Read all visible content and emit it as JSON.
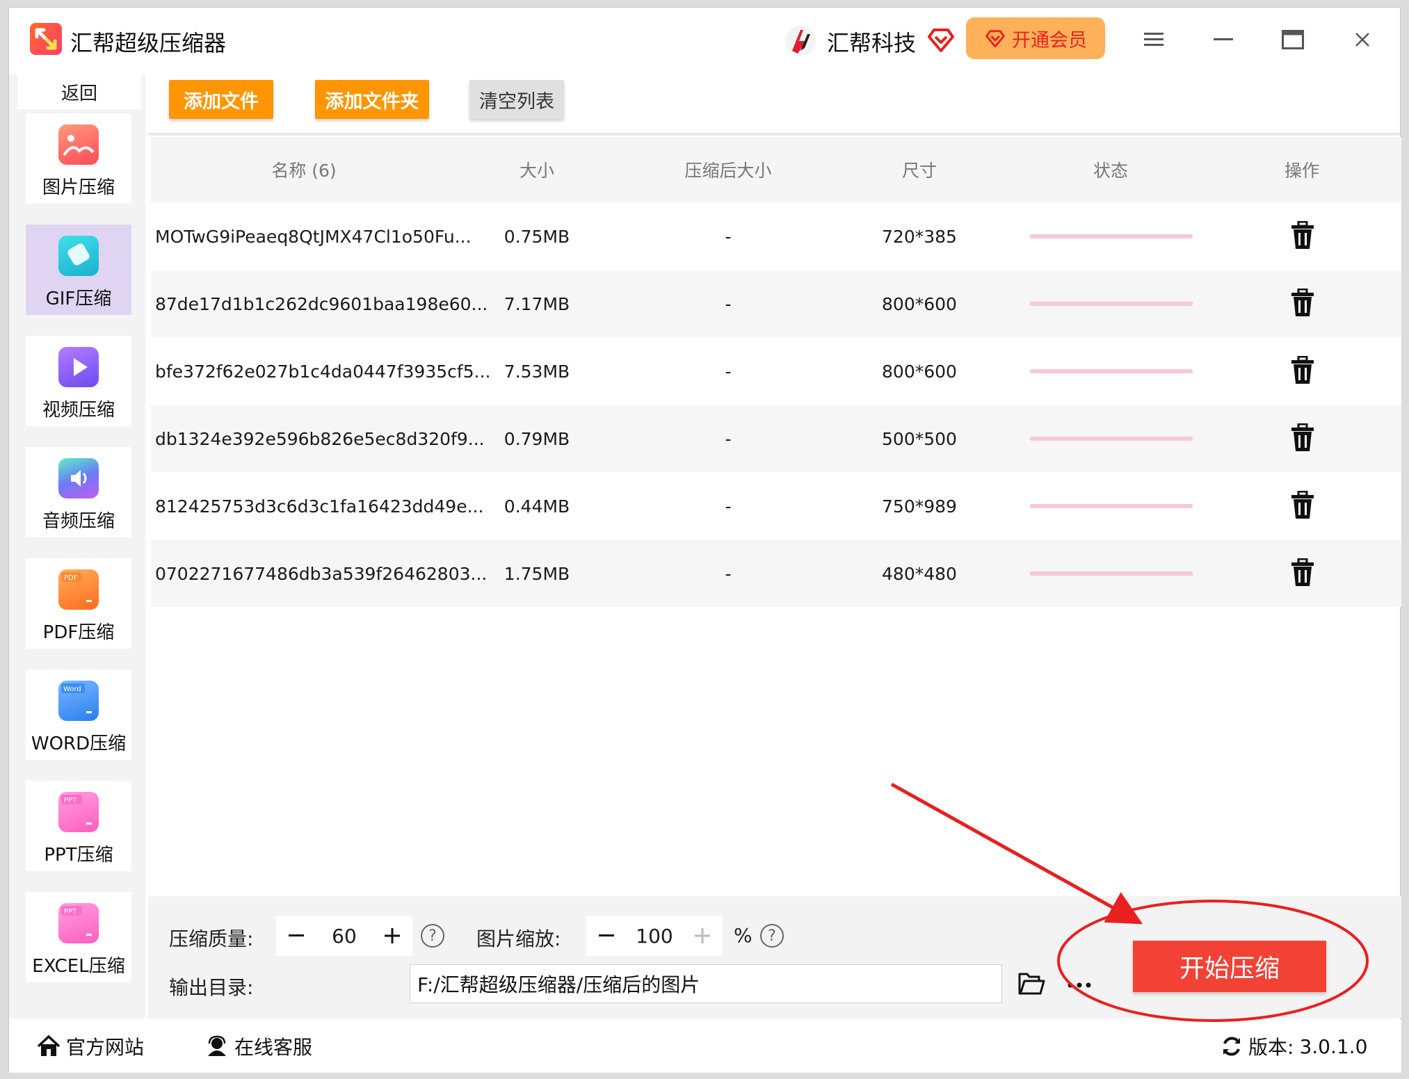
{
  "app": {
    "title": "汇帮超级压缩器",
    "brand_name": "汇帮科技",
    "vip_label": "开通会员"
  },
  "sidebar": {
    "back_label": "返回",
    "items": [
      {
        "label": "图片压缩",
        "icon": "image-icon",
        "color": "#ff5a5a",
        "active": false
      },
      {
        "label": "GIF压缩",
        "icon": "gif-icon",
        "color": "#2ac8d8",
        "active": true
      },
      {
        "label": "视频压缩",
        "icon": "video-icon",
        "color": "#8a5cf6",
        "active": false
      },
      {
        "label": "音频压缩",
        "icon": "audio-icon",
        "color": "#4aa8f0",
        "active": false
      },
      {
        "label": "PDF压缩",
        "icon": "pdf-icon",
        "color": "#ff7a2a",
        "badge": "PDF",
        "active": false
      },
      {
        "label": "WORD压缩",
        "icon": "word-icon",
        "color": "#3a8ef6",
        "badge": "Word",
        "active": false
      },
      {
        "label": "PPT压缩",
        "icon": "ppt-icon",
        "color": "#ff6ec7",
        "badge": "PPT",
        "active": false
      },
      {
        "label": "EXCEL压缩",
        "icon": "excel-icon",
        "color": "#ff6ec7",
        "badge": "PPT",
        "active": false
      }
    ]
  },
  "toolbar": {
    "add_file": "添加文件",
    "add_folder": "添加文件夹",
    "clear_list": "清空列表"
  },
  "table": {
    "headers": [
      "名称 (6)",
      "大小",
      "压缩后大小",
      "尺寸",
      "状态",
      "操作"
    ],
    "rows": [
      {
        "name": "MOTwG9iPeaeq8QtJMX47Cl1o50Fu...",
        "size": "0.75MB",
        "compressed": "-",
        "dims": "720*385"
      },
      {
        "name": "87de17d1b1c262dc9601baa198e60...",
        "size": "7.17MB",
        "compressed": "-",
        "dims": "800*600"
      },
      {
        "name": "bfe372f62e027b1c4da0447f3935cf5...",
        "size": "7.53MB",
        "compressed": "-",
        "dims": "800*600"
      },
      {
        "name": "db1324e392e596b826e5ec8d320f9...",
        "size": "0.79MB",
        "compressed": "-",
        "dims": "500*500"
      },
      {
        "name": "812425753d3c6d3c1fa16423dd49e...",
        "size": "0.44MB",
        "compressed": "-",
        "dims": "750*989"
      },
      {
        "name": "0702271677486db3a539f26462803...",
        "size": "1.75MB",
        "compressed": "-",
        "dims": "480*480"
      }
    ]
  },
  "settings": {
    "quality_label": "压缩质量:",
    "quality_value": "60",
    "scale_label": "图片缩放:",
    "scale_value": "100",
    "scale_unit": "%",
    "output_label": "输出目录:",
    "output_path": "F:/汇帮超级压缩器/压缩后的图片",
    "start_label": "开始压缩"
  },
  "footer": {
    "website": "官方网站",
    "support": "在线客服",
    "version_label": "版本:",
    "version": "3.0.1.0"
  },
  "colors": {
    "accent_orange": "#ff9500",
    "start_red": "#f24236",
    "annotation_red": "#e8201f",
    "status_pink": "#f5c9d8"
  }
}
